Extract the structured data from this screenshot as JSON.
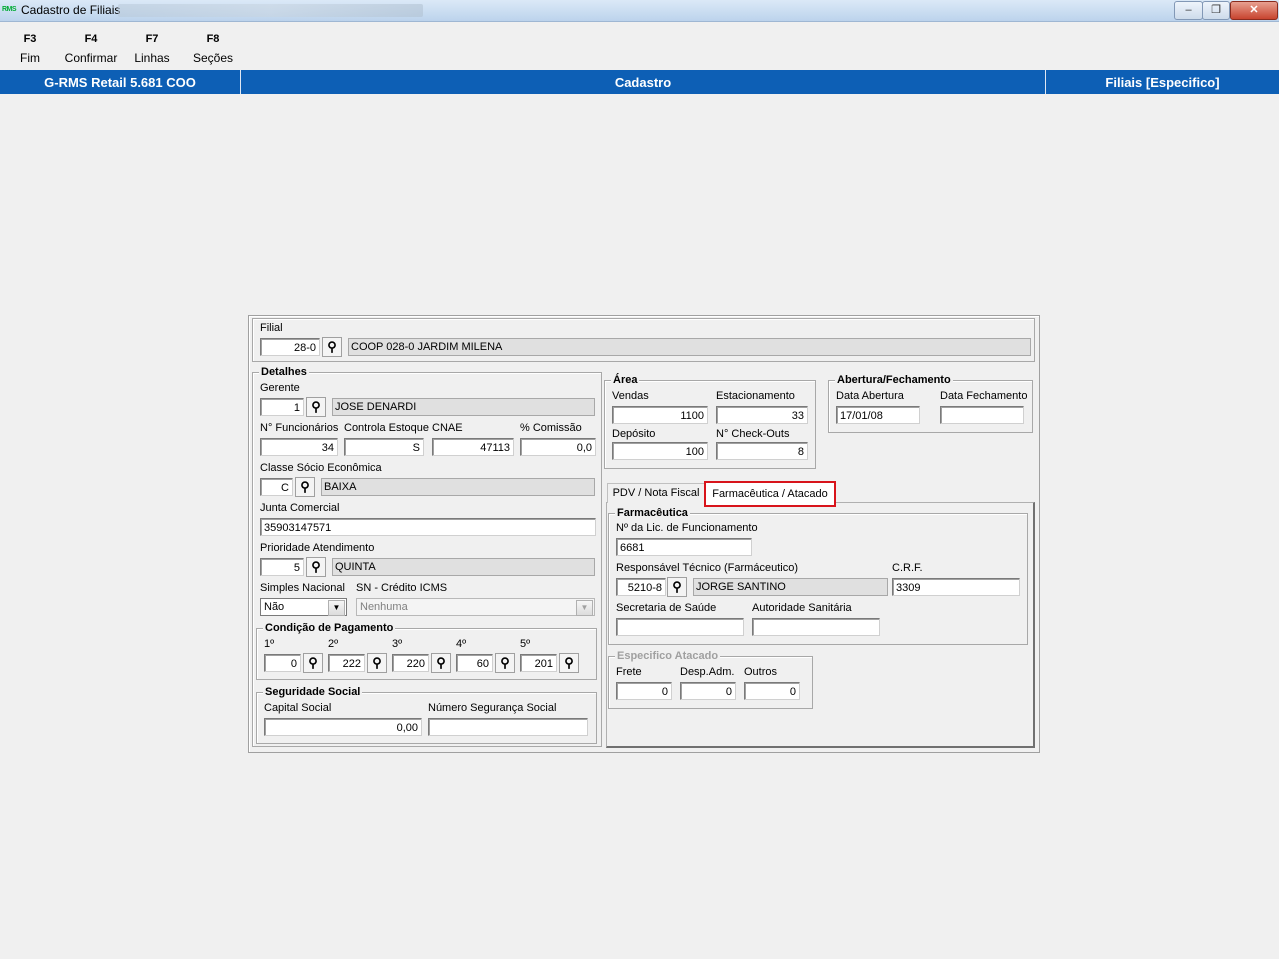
{
  "window": {
    "title": "Cadastro de Filiais",
    "app_icon_text": "RMS",
    "btn_minimize": "‒",
    "btn_maximize": "❐",
    "btn_close": "✕"
  },
  "fkeys": [
    {
      "key": "F3",
      "label": "Fim"
    },
    {
      "key": "F4",
      "label": "Confirmar"
    },
    {
      "key": "F7",
      "label": "Linhas"
    },
    {
      "key": "F8",
      "label": "Seções"
    }
  ],
  "banner": {
    "left": "G-RMS Retail 5.681 COO",
    "center": "Cadastro",
    "right": "Filiais [Especifico]"
  },
  "filial": {
    "label": "Filial",
    "code": "28-0",
    "name": "COOP 028-0  JARDIM MILENA"
  },
  "detalhes": {
    "title": "Detalhes",
    "gerente_label": "Gerente",
    "gerente_code": "1",
    "gerente_name": "JOSE DENARDI",
    "funcionarios_label": "N° Funcionários",
    "funcionarios": "34",
    "controla_label": "Controla Estoque",
    "controla": "S",
    "cnae_label": "CNAE",
    "cnae": "47113",
    "comissao_label": "% Comissão",
    "comissao": "0,0",
    "classe_label": "Classe Sócio Econômica",
    "classe_code": "C",
    "classe_name": "BAIXA",
    "junta_label": "Junta Comercial",
    "junta": "35903147571",
    "prioridade_label": "Prioridade Atendimento",
    "prioridade_code": "5",
    "prioridade_name": "QUINTA",
    "simples_label": "Simples Nacional",
    "simples": "Não",
    "sn_credito_label": "SN - Crédito ICMS",
    "sn_credito": "Nenhuma"
  },
  "pagamento": {
    "title": "Condição de Pagamento",
    "items": [
      {
        "label": "1º",
        "value": "0"
      },
      {
        "label": "2º",
        "value": "222"
      },
      {
        "label": "3º",
        "value": "220"
      },
      {
        "label": "4º",
        "value": "60"
      },
      {
        "label": "5º",
        "value": "201"
      }
    ]
  },
  "seguridade": {
    "title": "Seguridade Social",
    "capital_label": "Capital Social",
    "capital": "0,00",
    "numero_label": "Número Segurança Social",
    "numero": ""
  },
  "area": {
    "title": "Área",
    "vendas_label": "Vendas",
    "vendas": "1100",
    "estacionamento_label": "Estacionamento",
    "estacionamento": "33",
    "deposito_label": "Depósito",
    "deposito": "100",
    "checkouts_label": "N° Check-Outs",
    "checkouts": "8"
  },
  "abertura": {
    "title": "Abertura/Fechamento",
    "data_abertura_label": "Data Abertura",
    "data_abertura": "17/01/08",
    "data_fechamento_label": "Data Fechamento",
    "data_fechamento": ""
  },
  "tabs": [
    {
      "label": "PDV / Nota Fiscal"
    },
    {
      "label": "Farmacêutica / Atacado"
    }
  ],
  "farmaceutica": {
    "title": "Farmacêutica",
    "lic_label": "Nº da Lic. de Funcionamento",
    "lic": "6681",
    "resp_label": "Responsável Técnico (Farmáceutico)",
    "resp_code": "5210-8",
    "resp_name": "JORGE SANTINO",
    "crf_label": "C.R.F.",
    "crf": "3309",
    "secretaria_label": "Secretaria de Saúde",
    "secretaria": "",
    "autoridade_label": "Autoridade Sanitária",
    "autoridade": ""
  },
  "atacado": {
    "title": "Especifico Atacado",
    "frete_label": "Frete",
    "frete": "0",
    "desp_label": "Desp.Adm.",
    "desp": "0",
    "outros_label": "Outros",
    "outros": "0"
  },
  "icons": {
    "lookup": "binoculars-icon",
    "dropdown": "chevron-down-icon"
  }
}
